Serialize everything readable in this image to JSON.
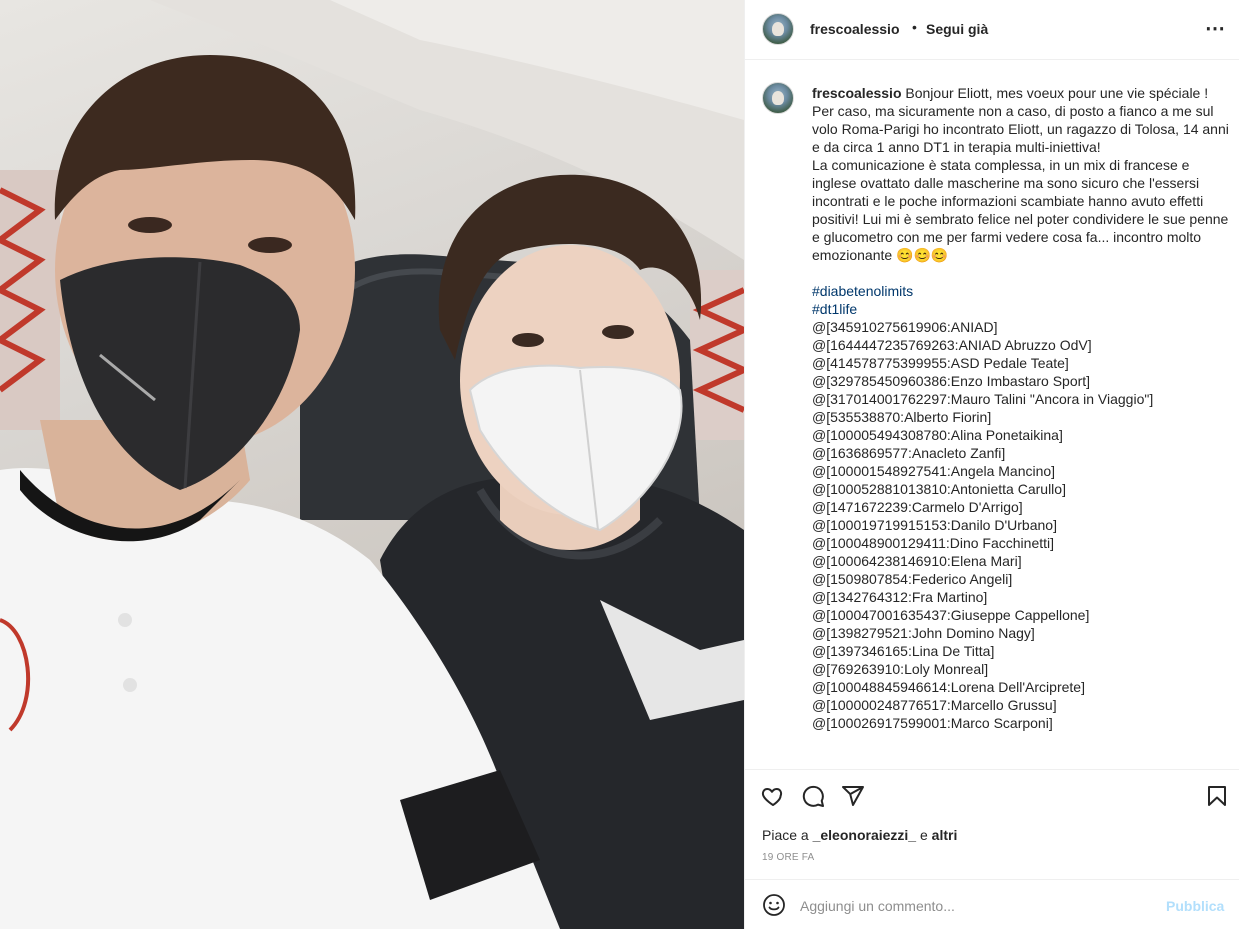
{
  "header": {
    "username": "frescoalessio",
    "separator": "•",
    "follow_status": "Segui già",
    "more_icon": "⋯"
  },
  "caption": {
    "username": "frescoalessio",
    "text": "Bonjour Eliott, mes voeux pour une vie spéciale !\nPer caso, ma sicuramente non a caso, di posto a fianco a me sul volo Roma-Parigi ho incontrato Eliott, un ragazzo di Tolosa, 14 anni e da circa 1 anno DT1 in terapia multi-iniettiva!\nLa comunicazione è stata complessa, in un mix di francese e inglese ovattato dalle mascherine ma sono sicuro che l'essersi incontrati e le poche informazioni scambiate hanno avuto effetti positivi! Lui mi è sembrato felice nel poter condividere le sue penne e glucometro con me per farmi vedere cosa fa... incontro molto emozionante 😊😊😊",
    "hashtags": [
      "#diabetenolimits",
      "#dt1life"
    ],
    "mentions": [
      "@[345910275619906:ANIAD]",
      "@[1644447235769263:ANIAD Abruzzo OdV]",
      "@[414578775399955:ASD Pedale Teate]",
      "@[329785450960386:Enzo Imbastaro Sport]",
      "@[317014001762297:Mauro Talini \"Ancora in Viaggio\"]",
      "@[535538870:Alberto Fiorin]",
      "@[100005494308780:Alina Ponetaikina]",
      "@[1636869577:Anacleto Zanfi]",
      "@[100001548927541:Angela Mancino]",
      "@[100052881013810:Antonietta Carullo]",
      "@[1471672239:Carmelo D'Arrigo]",
      "@[100019719915153:Danilo D'Urbano]",
      "@[100048900129411:Dino Facchinetti]",
      "@[100064238146910:Elena Mari]",
      "@[1509807854:Federico Angeli]",
      "@[1342764312:Fra Martino]",
      "@[100047001635437:Giuseppe Cappellone]",
      "@[1398279521:John Domino Nagy]",
      "@[1397346165:Lina De Titta]",
      "@[769263910:Loly Monreal]",
      "@[100048845946614:Lorena Dell'Arciprete]",
      "@[100000248776517:Marcello Grussu]",
      "@[100026917599001:Marco Scarponi]"
    ]
  },
  "likes": {
    "prefix": "Piace a",
    "user": "_eleonoraiezzi_",
    "middle": "e",
    "others": "altri"
  },
  "time_ago": "19 ORE FA",
  "comment_box": {
    "placeholder": "Aggiungi un commento...",
    "publish_label": "Pubblica"
  },
  "icons": [
    "heart-icon",
    "comment-icon",
    "share-icon",
    "bookmark-icon",
    "emoji-icon"
  ],
  "colors": {
    "link": "#00376b",
    "muted": "#8e8e8e",
    "publish_disabled": "#b2dffc",
    "border": "#efefef"
  }
}
